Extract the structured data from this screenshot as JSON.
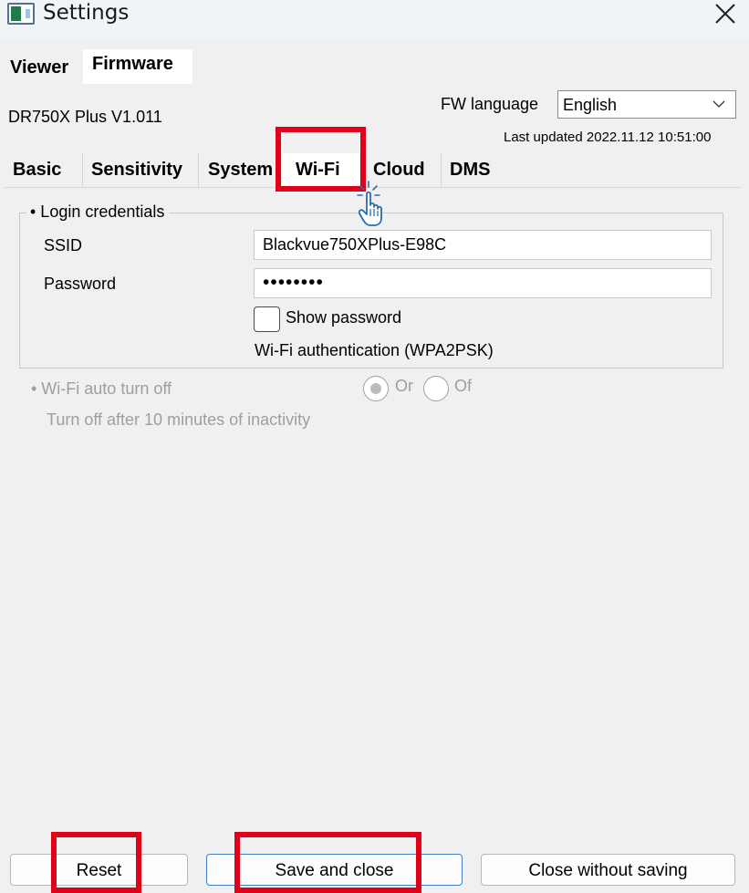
{
  "window": {
    "title": "Settings",
    "app_icon": "app-icon",
    "close_icon": "close-icon"
  },
  "top_tabs": [
    {
      "label": "Viewer",
      "active": false
    },
    {
      "label": "Firmware",
      "active": true
    }
  ],
  "device": {
    "model_version": "DR750X Plus  V1.011"
  },
  "fw_language": {
    "label": "FW language",
    "selected": "English"
  },
  "last_updated": "Last updated 2022.11.12 10:51:00",
  "sub_tabs": [
    {
      "label": "Basic",
      "active": false
    },
    {
      "label": "Sensitivity",
      "active": false
    },
    {
      "label": "System",
      "active": false
    },
    {
      "label": "Wi-Fi",
      "active": true
    },
    {
      "label": "Cloud",
      "active": false
    },
    {
      "label": "DMS",
      "active": false
    }
  ],
  "login_credentials": {
    "title": "• Login credentials",
    "ssid_label": "SSID",
    "ssid_value": "Blackvue750XPlus-E98C",
    "password_label": "Password",
    "password_value": "••••••••",
    "show_password_label": "Show password",
    "show_password_checked": false,
    "auth_text": "Wi-Fi authentication (WPA2PSK)"
  },
  "auto_turn_off": {
    "title": "• Wi-Fi auto turn off",
    "on_label": "Or",
    "off_label": "Of",
    "selected": "on",
    "description": "Turn off after 10 minutes of inactivity",
    "disabled": true
  },
  "buttons": {
    "reset": "Reset",
    "save_close": "Save and close",
    "close_no_save": "Close without saving"
  },
  "annotations": {
    "highlight_color": "#e0001a",
    "cursor_icon": "hand-pointer-icon"
  }
}
